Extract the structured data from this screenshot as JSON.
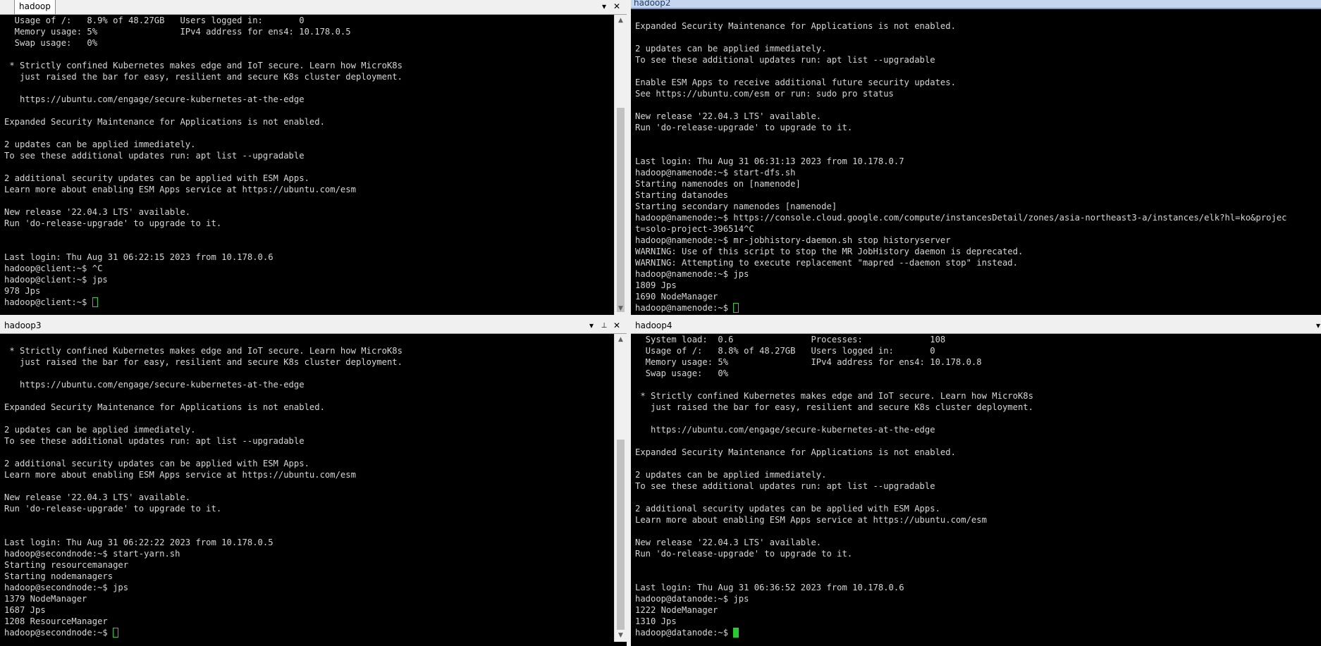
{
  "panes": {
    "top_left": {
      "tab_label": "hadoop",
      "lines": [
        "  Usage of /:   8.9% of 48.27GB   Users logged in:       0",
        "  Memory usage: 5%                IPv4 address for ens4: 10.178.0.5",
        "  Swap usage:   0%",
        "",
        " * Strictly confined Kubernetes makes edge and IoT secure. Learn how MicroK8s",
        "   just raised the bar for easy, resilient and secure K8s cluster deployment.",
        "",
        "   https://ubuntu.com/engage/secure-kubernetes-at-the-edge",
        "",
        "Expanded Security Maintenance for Applications is not enabled.",
        "",
        "2 updates can be applied immediately.",
        "To see these additional updates run: apt list --upgradable",
        "",
        "2 additional security updates can be applied with ESM Apps.",
        "Learn more about enabling ESM Apps service at https://ubuntu.com/esm",
        "",
        "New release '22.04.3 LTS' available.",
        "Run 'do-release-upgrade' to upgrade to it.",
        "",
        "",
        "Last login: Thu Aug 31 06:22:15 2023 from 10.178.0.6",
        "hadoop@client:~$ ^C",
        "hadoop@client:~$ jps",
        "978 Jps"
      ],
      "prompt": "hadoop@client:~$ "
    },
    "top_right": {
      "tab_label": "hadoop2",
      "lines": [
        "",
        "Expanded Security Maintenance for Applications is not enabled.",
        "",
        "2 updates can be applied immediately.",
        "To see these additional updates run: apt list --upgradable",
        "",
        "Enable ESM Apps to receive additional future security updates.",
        "See https://ubuntu.com/esm or run: sudo pro status",
        "",
        "New release '22.04.3 LTS' available.",
        "Run 'do-release-upgrade' to upgrade to it.",
        "",
        "",
        "Last login: Thu Aug 31 06:31:13 2023 from 10.178.0.7",
        "hadoop@namenode:~$ start-dfs.sh",
        "Starting namenodes on [namenode]",
        "Starting datanodes",
        "Starting secondary namenodes [namenode]",
        "hadoop@namenode:~$ https://console.cloud.google.com/compute/instancesDetail/zones/asia-northeast3-a/instances/elk?hl=ko&projec",
        "t=solo-project-396514^C",
        "hadoop@namenode:~$ mr-jobhistory-daemon.sh stop historyserver",
        "WARNING: Use of this script to stop the MR JobHistory daemon is deprecated.",
        "WARNING: Attempting to execute replacement \"mapred --daemon stop\" instead.",
        "hadoop@namenode:~$ jps",
        "1809 Jps",
        "1690 NodeManager"
      ],
      "prompt": "hadoop@namenode:~$ "
    },
    "bottom_left": {
      "tab_label": "hadoop3",
      "lines": [
        "",
        " * Strictly confined Kubernetes makes edge and IoT secure. Learn how MicroK8s",
        "   just raised the bar for easy, resilient and secure K8s cluster deployment.",
        "",
        "   https://ubuntu.com/engage/secure-kubernetes-at-the-edge",
        "",
        "Expanded Security Maintenance for Applications is not enabled.",
        "",
        "2 updates can be applied immediately.",
        "To see these additional updates run: apt list --upgradable",
        "",
        "2 additional security updates can be applied with ESM Apps.",
        "Learn more about enabling ESM Apps service at https://ubuntu.com/esm",
        "",
        "New release '22.04.3 LTS' available.",
        "Run 'do-release-upgrade' to upgrade to it.",
        "",
        "",
        "Last login: Thu Aug 31 06:22:22 2023 from 10.178.0.5",
        "hadoop@secondnode:~$ start-yarn.sh",
        "Starting resourcemanager",
        "Starting nodemanagers",
        "hadoop@secondnode:~$ jps",
        "1379 NodeManager",
        "1687 Jps",
        "1208 ResourceManager"
      ],
      "prompt": "hadoop@secondnode:~$ "
    },
    "bottom_right": {
      "tab_label": "hadoop4",
      "lines": [
        "  System load:  0.6               Processes:             108",
        "  Usage of /:   8.8% of 48.27GB   Users logged in:       0",
        "  Memory usage: 5%                IPv4 address for ens4: 10.178.0.8",
        "  Swap usage:   0%",
        "",
        " * Strictly confined Kubernetes makes edge and IoT secure. Learn how MicroK8s",
        "   just raised the bar for easy, resilient and secure K8s cluster deployment.",
        "",
        "   https://ubuntu.com/engage/secure-kubernetes-at-the-edge",
        "",
        "Expanded Security Maintenance for Applications is not enabled.",
        "",
        "2 updates can be applied immediately.",
        "To see these additional updates run: apt list --upgradable",
        "",
        "2 additional security updates can be applied with ESM Apps.",
        "Learn more about enabling ESM Apps service at https://ubuntu.com/esm",
        "",
        "New release '22.04.3 LTS' available.",
        "Run 'do-release-upgrade' to upgrade to it.",
        "",
        "",
        "Last login: Thu Aug 31 06:36:52 2023 from 10.178.0.6",
        "hadoop@datanode:~$ jps",
        "1222 NodeManager",
        "1310 Jps"
      ],
      "prompt": "hadoop@datanode:~$ "
    }
  },
  "icons": {
    "dropdown": "▾",
    "close": "✕",
    "pin": "📌",
    "scroll_up": "▲",
    "scroll_down": "▼"
  },
  "colors": {
    "terminal_bg": "#000000",
    "terminal_fg": "#d6d6d6",
    "cursor": "#22d02a"
  }
}
